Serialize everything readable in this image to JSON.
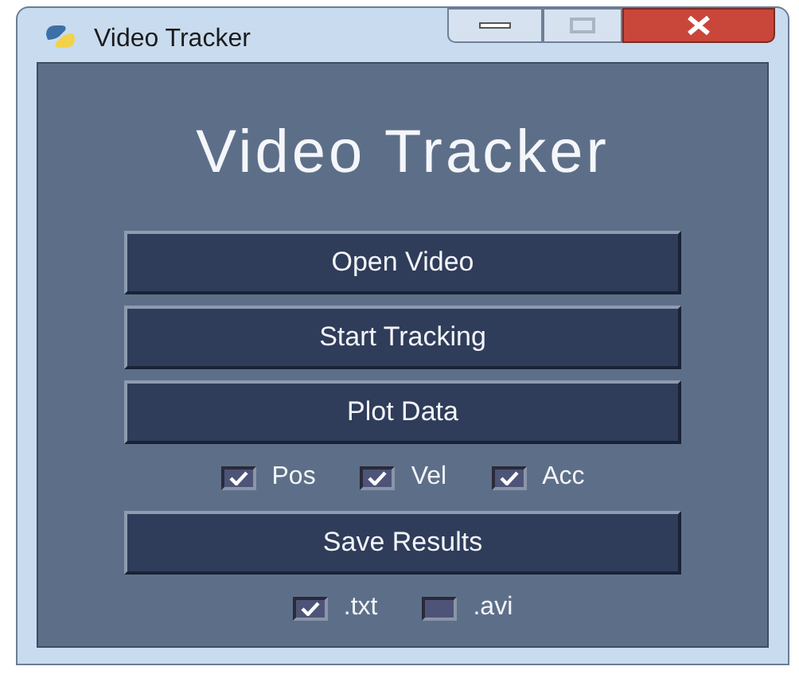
{
  "window": {
    "title": "Video Tracker"
  },
  "heading": "Video Tracker",
  "controls": [
    {
      "kind": "button",
      "label": "Open Video"
    },
    {
      "kind": "button",
      "label": "Start Tracking"
    },
    {
      "kind": "button",
      "label": "Plot Data"
    },
    {
      "kind": "checkboxes",
      "items": [
        {
          "label": "Pos",
          "checked": true
        },
        {
          "label": "Vel",
          "checked": true
        },
        {
          "label": "Acc",
          "checked": true
        }
      ]
    },
    {
      "kind": "button",
      "label": "Save Results"
    },
    {
      "kind": "checkboxes",
      "items": [
        {
          "label": ".txt",
          "checked": true
        },
        {
          "label": ".avi",
          "checked": false
        }
      ]
    }
  ]
}
